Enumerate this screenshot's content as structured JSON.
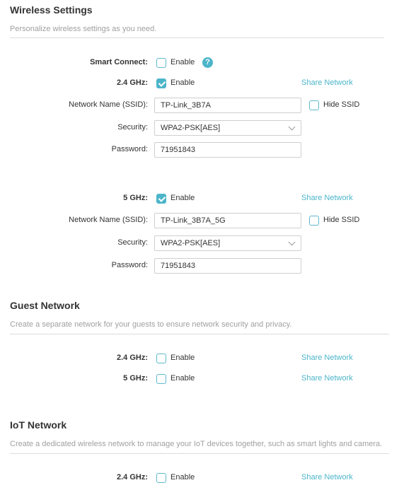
{
  "wireless": {
    "title": "Wireless Settings",
    "desc": "Personalize wireless settings as you need.",
    "smart_connect": {
      "label": "Smart Connect:",
      "option": "Enable",
      "checked": false,
      "help": "?"
    },
    "band24": {
      "label": "2.4 GHz:",
      "option": "Enable",
      "checked": true,
      "share": "Share Network",
      "ssid_label": "Network Name (SSID):",
      "ssid": "TP-Link_3B7A",
      "hide_ssid": "Hide SSID",
      "security_label": "Security:",
      "security": "WPA2-PSK[AES]",
      "password_label": "Password:",
      "password": "71951843"
    },
    "band5": {
      "label": "5 GHz:",
      "option": "Enable",
      "checked": true,
      "share": "Share Network",
      "ssid_label": "Network Name (SSID):",
      "ssid": "TP-Link_3B7A_5G",
      "hide_ssid": "Hide SSID",
      "security_label": "Security:",
      "security": "WPA2-PSK[AES]",
      "password_label": "Password:",
      "password": "71951843"
    }
  },
  "guest": {
    "title": "Guest Network",
    "desc": "Create a separate network for your guests to ensure network security and privacy.",
    "band24": {
      "label": "2.4 GHz:",
      "option": "Enable",
      "checked": false,
      "share": "Share Network"
    },
    "band5": {
      "label": "5 GHz:",
      "option": "Enable",
      "checked": false,
      "share": "Share Network"
    }
  },
  "iot": {
    "title": "IoT Network",
    "desc": "Create a dedicated wireless network to manage your IoT devices together, such as smart lights and camera.",
    "band24": {
      "label": "2.4 GHz:",
      "option": "Enable",
      "checked": false,
      "share": "Share Network"
    }
  },
  "colors": {
    "accent": "#4cb5c9"
  }
}
